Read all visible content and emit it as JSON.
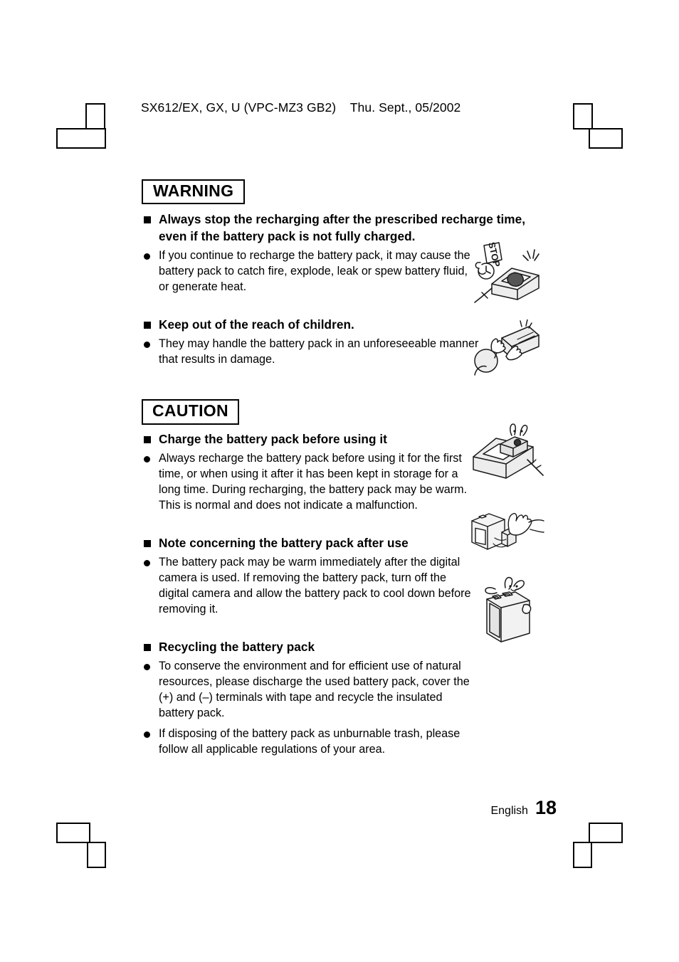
{
  "header": {
    "text": "SX612/EX, GX, U (VPC-MZ3 GB2)    Thu. Sept., 05/2002"
  },
  "sections": [
    {
      "label": "WARNING",
      "items": [
        {
          "heading": "Always stop the recharging after the prescribed recharge time, even if the battery pack is not fully charged.",
          "bullets": [
            "If you continue to recharge the battery pack, it may cause the battery pack to catch fire, explode, leak or spew battery fluid, or generate heat."
          ],
          "illustration": "charger-overheating-stop-icon"
        },
        {
          "heading": "Keep out of the reach of children.",
          "bullets": [
            "They may handle the battery pack in an unforeseeable manner that results in damage."
          ],
          "illustration": "child-handling-battery-icon"
        }
      ]
    },
    {
      "label": "CAUTION",
      "items": [
        {
          "heading": "Charge the battery pack before using it",
          "bullets": [
            "Always recharge the battery pack before using it for the first time, or when using it after it has been kept in storage for a long time. During recharging, the battery pack may be warm. This is normal and does not indicate a malfunction."
          ],
          "illustration": "battery-charger-icon"
        },
        {
          "heading": "Note concerning the battery pack after use",
          "bullets": [
            "The battery pack may be warm immediately after the digital camera is used. If removing the battery pack, turn off the digital camera and allow the battery pack to cool down before removing it."
          ],
          "illustration": "removing-battery-from-camera-icon"
        },
        {
          "heading": "Recycling the battery pack",
          "bullets": [
            "To conserve the environment and for efficient use of natural resources, please discharge the used battery pack, cover the (+) and (–) terminals with tape and recycle the insulated battery pack.",
            "If disposing of the battery pack as unburnable trash, please follow all applicable regulations of your area."
          ],
          "illustration": "taped-battery-pack-icon"
        }
      ]
    }
  ],
  "footer": {
    "language": "English",
    "page_number": "18"
  },
  "colors": {
    "text": "#000000",
    "page_background": "#ffffff",
    "illustration_fill": "#e8e8e8",
    "illustration_stroke": "#1a1a1a"
  }
}
